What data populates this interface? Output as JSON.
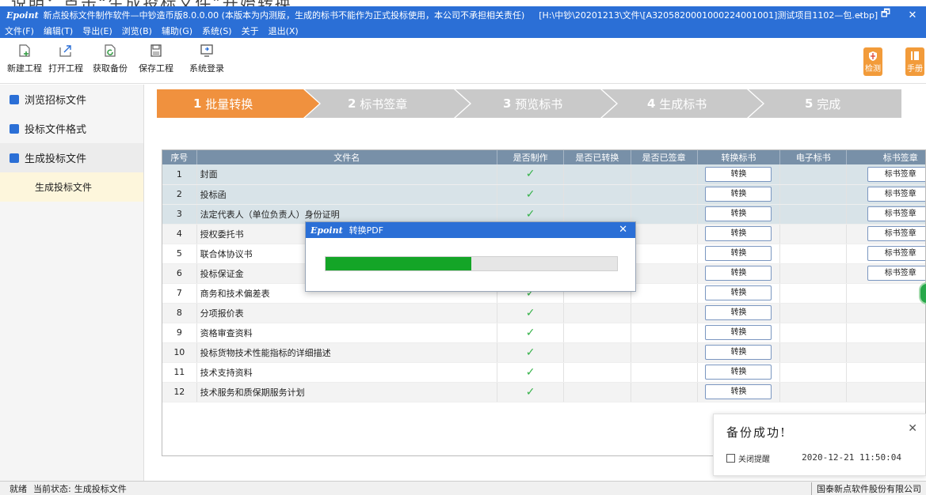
{
  "caption": "说明：点击“生成投标文件”开始转换",
  "window": {
    "logo": "Epoint",
    "title": "新点投标文件制作软件—中钞造币版8.0.0.00 (本版本为内测版，生成的标书不能作为正式投标使用，本公司不承担相关责任)",
    "path": "[H:\\中钞\\20201213\\文件\\[A3205820001000224001001]测试项目1102—包.etbp]",
    "minimize": "–",
    "restore": "🗗",
    "close": "✕"
  },
  "menu": [
    "文件(F)",
    "编辑(T)",
    "导出(E)",
    "浏览(B)",
    "辅助(G)",
    "系统(S)",
    "关于",
    "退出(X)"
  ],
  "toolbar": {
    "new": "新建工程",
    "open": "打开工程",
    "backup": "获取备份",
    "save": "保存工程",
    "login": "系统登录",
    "detect": "检测",
    "manual": "手册"
  },
  "sidebar": {
    "items": [
      "浏览招标文件",
      "投标文件格式",
      "生成投标文件"
    ],
    "sub": "生成投标文件"
  },
  "steps": [
    {
      "num": "1",
      "label": "批量转换"
    },
    {
      "num": "2",
      "label": "标书签章"
    },
    {
      "num": "3",
      "label": "预览标书"
    },
    {
      "num": "4",
      "label": "生成标书"
    },
    {
      "num": "5",
      "label": "完成"
    }
  ],
  "colors": {
    "active_step": "#f0913e",
    "inactive_step": "#c9c9c9",
    "accent": "#2b6fd6",
    "progress": "#14a527"
  },
  "table": {
    "headers": [
      "序号",
      "文件名",
      "是否制作",
      "是否已转换",
      "是否已签章",
      "转换标书",
      "电子标书",
      "标书签章"
    ],
    "rows": [
      {
        "no": "1",
        "name": "封面",
        "made": "✓",
        "convert": "转换",
        "sign": "标书签章"
      },
      {
        "no": "2",
        "name": "投标函",
        "made": "✓",
        "convert": "转换",
        "sign": "标书签章"
      },
      {
        "no": "3",
        "name": "法定代表人（单位负责人）身份证明",
        "made": "✓",
        "convert": "转换",
        "sign": "标书签章"
      },
      {
        "no": "4",
        "name": "授权委托书",
        "made": "",
        "convert": "转换",
        "sign": "标书签章"
      },
      {
        "no": "5",
        "name": "联合体协议书",
        "made": "",
        "convert": "转换",
        "sign": "标书签章"
      },
      {
        "no": "6",
        "name": "投标保证金",
        "made": "",
        "convert": "转换",
        "sign": "标书签章"
      },
      {
        "no": "7",
        "name": "商务和技术偏差表",
        "made": "✓",
        "convert": "转换",
        "sign": ""
      },
      {
        "no": "8",
        "name": "分项报价表",
        "made": "✓",
        "convert": "转换",
        "sign": ""
      },
      {
        "no": "9",
        "name": "资格审查资料",
        "made": "✓",
        "convert": "转换",
        "sign": ""
      },
      {
        "no": "10",
        "name": "投标货物技术性能指标的详细描述",
        "made": "✓",
        "convert": "转换",
        "sign": ""
      },
      {
        "no": "11",
        "name": "技术支持资料",
        "made": "✓",
        "convert": "转换",
        "sign": ""
      },
      {
        "no": "12",
        "name": "技术服务和质保期服务计划",
        "made": "✓",
        "convert": "转换",
        "sign": ""
      }
    ]
  },
  "dialog": {
    "logo": "Epoint",
    "title": "转换PDF",
    "close": "✕",
    "progress": 0.5
  },
  "toast": {
    "title": "备份成功!",
    "close": "✕",
    "checkbox_label": "关闭提醒",
    "time": "2020-12-21 11:50:04"
  },
  "status": {
    "ready": "就绪",
    "state_label": "当前状态:",
    "state_value": "生成投标文件",
    "company": "国泰新点软件股份有限公司"
  }
}
